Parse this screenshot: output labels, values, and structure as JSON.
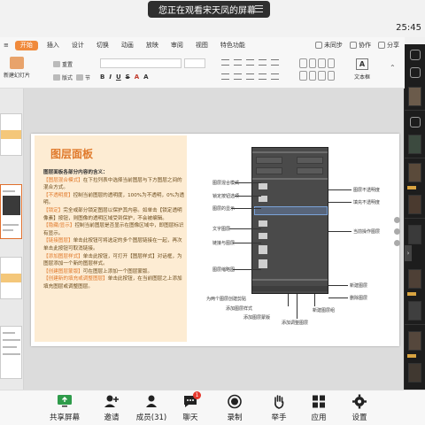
{
  "meeting": {
    "share_notice": "您正在观看宋天凤的屏幕",
    "clock": "25:45",
    "bottom_bar": [
      {
        "label": "共享屏幕",
        "icon": "share-screen-icon"
      },
      {
        "label": "邀请",
        "icon": "invite-icon"
      },
      {
        "label": "成员(31)",
        "icon": "members-icon"
      },
      {
        "label": "聊天",
        "icon": "chat-icon",
        "badge": "1"
      },
      {
        "label": "录制",
        "icon": "record-icon"
      },
      {
        "label": "举手",
        "icon": "raise-hand-icon"
      },
      {
        "label": "应用",
        "icon": "apps-icon"
      },
      {
        "label": "设置",
        "icon": "settings-icon"
      }
    ]
  },
  "ribbon": {
    "tabs": [
      "开始",
      "插入",
      "设计",
      "切换",
      "动画",
      "放映",
      "审阅",
      "视图",
      "特色功能"
    ],
    "active_tab": "开始",
    "right": {
      "unsync": "未同步",
      "collab": "协作",
      "share": "分享"
    },
    "tools": {
      "new_slide": "新建幻灯片",
      "layout": "版式",
      "reset": "重置",
      "section": "节",
      "textbox": "文本框"
    },
    "format_buttons": [
      "B",
      "I",
      "U",
      "S",
      "A",
      "A"
    ]
  },
  "slide": {
    "title": "图层面板",
    "paragraphs": [
      {
        "head": "图层面板各部分内容的含义：",
        "body": ""
      },
      {
        "head": "【图层混合模式】",
        "body": "在下拉列表中选择当前图层与下方图层之间的混合方式。"
      },
      {
        "head": "【不透明度】",
        "body": "控制当前图层的透明度，100%为不透明，0%为透明。"
      },
      {
        "head": "【锁定】",
        "body": "完全或部分锁定图层以保护其内容。如单击【锁定透明像素】按钮，则图像的透明区域受到保护，不会被编辑。"
      },
      {
        "head": "【隐藏/显示】",
        "body": "控制当前图层是否显示在图像区域中，即图层标识有显示。"
      },
      {
        "head": "【链接图层】",
        "body": "单击此按钮可将选定的多个图层链接在一起，再次单击此按钮可取消链接。"
      },
      {
        "head": "【添加图层样式】",
        "body": "单击此按钮，可打开【图层样式】对话框，为图层添加一个新的图层样式。"
      },
      {
        "head": "【创建图层蒙版】",
        "body": "可在图层上添加一个图层蒙版。"
      },
      {
        "head": "【创建新的填充或调整图层】",
        "body": "单击此按钮，在当前图层之上添加填充图层或调整图层。"
      }
    ],
    "annotations": {
      "left": [
        "图层混合模式",
        "锁定按钮选项",
        "图层的显示",
        "文字图层",
        "链接与图层",
        "图层缩略图",
        "为两个图层创建剪贴",
        "添加图层样式",
        "添加图层蒙版"
      ],
      "right": [
        "图层不透明度",
        "填充不透明度",
        "当前操作图层",
        "新建图层",
        "删除图层"
      ],
      "bottom": [
        "添加调整图层",
        "新建图层组"
      ]
    }
  },
  "colors": {
    "accent": "#e07a2c",
    "panel_bg": "#fdecd3",
    "tab_active": "#f08a3c",
    "badge": "#e5372c"
  }
}
